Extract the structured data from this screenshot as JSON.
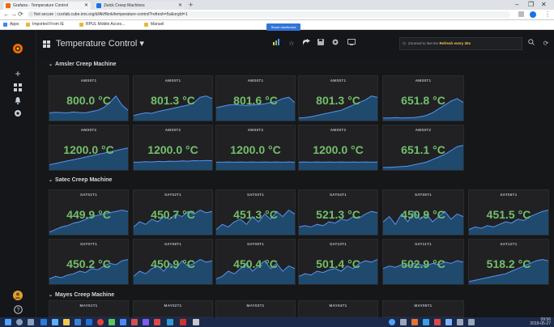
{
  "browser": {
    "tabs": [
      {
        "title": "Grafana - Temperature Control",
        "fav_color": "#f46800"
      },
      {
        "title": "Zwick Creep Machines",
        "fav_color": "#1a73e8"
      }
    ],
    "new_tab": "+",
    "window_controls": [
      "–",
      "❐",
      "✕"
    ],
    "nav": [
      "←",
      "→",
      "⟳",
      "⌂"
    ],
    "url_security": "Not secure",
    "url": "ccsrlab.cube.inrs.org/d/AkHbnk/temperature-control?refresh=5s&orgId=1",
    "bookmarks": [
      "Apps",
      "Imported From IE",
      "RPUL Mobile Acces...",
      "Manuel"
    ]
  },
  "sidebar": {
    "icons": [
      "grafana-logo-icon",
      "plus-icon",
      "dashboards-icon",
      "alert-bell-icon",
      "gear-icon",
      "user-avatar-icon",
      "help-icon"
    ]
  },
  "topnav": {
    "title": "Temperature Control ▾",
    "tooltip": "Share dashboard",
    "time_range": "Zoomed to last 5m",
    "refresh_label": "Refresh every 30s"
  },
  "colors": {
    "value": "#73bf69",
    "spark_fill": "#1f4a6e",
    "spark_line": "#5794f2",
    "panel_bg": "#212124"
  },
  "rows": [
    {
      "title": "Amsler Creep Machine",
      "panels": [
        {
          "title": "AMS0T1",
          "value": "800.0 °C",
          "spark": [
            0.3,
            0.32,
            0.31,
            0.3,
            0.33,
            0.31,
            0.3,
            0.35,
            0.4,
            0.5,
            0.7,
            0.95,
            0.6,
            0.4
          ]
        },
        {
          "title": "AMS0T1",
          "value": "801.3 °C",
          "spark": [
            0.2,
            0.25,
            0.3,
            0.28,
            0.35,
            0.4,
            0.45,
            0.5,
            0.55,
            0.6,
            0.7,
            0.9,
            0.95,
            0.85
          ]
        },
        {
          "title": "AMS0T1",
          "value": "801.6 °C",
          "spark": [
            0.5,
            0.55,
            0.6,
            0.62,
            0.6,
            0.58,
            0.6,
            0.62,
            0.65,
            0.7,
            0.75,
            0.85,
            0.9,
            0.7
          ]
        },
        {
          "title": "AMS0T1",
          "value": "801.3 °C",
          "spark": [
            0.1,
            0.12,
            0.15,
            0.2,
            0.25,
            0.3,
            0.35,
            0.4,
            0.5,
            0.6,
            0.7,
            0.8,
            0.95,
            0.9
          ]
        },
        {
          "title": "AMS0T1",
          "value": "651.8 °C",
          "spark": [
            0.1,
            0.1,
            0.12,
            0.1,
            0.11,
            0.12,
            0.15,
            0.2,
            0.3,
            0.45,
            0.6,
            0.75,
            0.85,
            0.7
          ]
        }
      ]
    },
    {
      "title": "",
      "panels": [
        {
          "title": "AMS0T2",
          "value": "1200.0 °C",
          "spark": [
            0.2,
            0.25,
            0.3,
            0.35,
            0.4,
            0.45,
            0.5,
            0.55,
            0.6,
            0.65,
            0.7,
            0.75,
            0.8,
            0.85
          ]
        },
        {
          "title": "AMS0T2",
          "value": "1200.0 °C",
          "spark": [
            0.3,
            0.3,
            0.32,
            0.31,
            0.33,
            0.32,
            0.34,
            0.33,
            0.35,
            0.34,
            0.36,
            0.35,
            0.37,
            0.36
          ]
        },
        {
          "title": "AMS0T2",
          "value": "1200.0 °C",
          "spark": [
            0.3,
            0.3,
            0.31,
            0.3,
            0.31,
            0.3,
            0.31,
            0.3,
            0.31,
            0.3,
            0.31,
            0.3,
            0.31,
            0.3
          ]
        },
        {
          "title": "AMS0T2",
          "value": "1200.0 °C",
          "spark": [
            0.3,
            0.31,
            0.3,
            0.31,
            0.3,
            0.31,
            0.3,
            0.31,
            0.3,
            0.31,
            0.3,
            0.31,
            0.3,
            0.31
          ]
        },
        {
          "title": "AMS0T2",
          "value": "651.1 °C",
          "spark": [
            0.1,
            0.1,
            0.12,
            0.13,
            0.15,
            0.2,
            0.25,
            0.3,
            0.4,
            0.5,
            0.6,
            0.75,
            0.9,
            0.95
          ]
        }
      ]
    },
    {
      "title": "Satec Creep Machine",
      "panels": [
        {
          "title": "SAT01T1",
          "value": "449.9 °C",
          "spark": [
            0.1,
            0.2,
            0.3,
            0.35,
            0.45,
            0.5,
            0.6,
            0.7,
            0.75,
            0.8,
            0.85,
            0.9,
            0.95,
            0.9
          ]
        },
        {
          "title": "SAT02T1",
          "value": "450.7 °C",
          "spark": [
            0.3,
            0.5,
            0.4,
            0.6,
            0.5,
            0.7,
            0.6,
            0.8,
            0.7,
            0.9,
            0.8,
            0.95,
            0.85,
            0.9
          ]
        },
        {
          "title": "SAT03T1",
          "value": "451.3 °C",
          "spark": [
            0.2,
            0.4,
            0.3,
            0.5,
            0.6,
            0.4,
            0.7,
            0.5,
            0.8,
            0.6,
            0.9,
            0.7,
            0.95,
            0.8
          ]
        },
        {
          "title": "SAT04T1",
          "value": "521.3 °C",
          "spark": [
            0.3,
            0.35,
            0.3,
            0.4,
            0.35,
            0.5,
            0.45,
            0.6,
            0.55,
            0.7,
            0.65,
            0.8,
            0.9,
            0.85
          ]
        },
        {
          "title": "SAT05T1",
          "value": "450.9 °C",
          "spark": [
            0.5,
            0.7,
            0.4,
            0.8,
            0.5,
            0.9,
            0.6,
            0.8,
            0.5,
            0.7,
            0.9,
            0.6,
            0.8,
            0.7
          ]
        },
        {
          "title": "SAT06T1",
          "value": "451.5 °C",
          "spark": [
            0.2,
            0.3,
            0.25,
            0.35,
            0.3,
            0.4,
            0.5,
            0.45,
            0.6,
            0.55,
            0.7,
            0.8,
            0.9,
            0.95
          ]
        }
      ]
    },
    {
      "title": "",
      "panels": [
        {
          "title": "SAT07T1",
          "value": "450.2 °C",
          "spark": [
            0.2,
            0.3,
            0.25,
            0.35,
            0.4,
            0.5,
            0.45,
            0.6,
            0.55,
            0.7,
            0.8,
            0.75,
            0.9,
            0.95
          ]
        },
        {
          "title": "SAT08T1",
          "value": "450.9 °C",
          "spark": [
            0.3,
            0.5,
            0.4,
            0.6,
            0.7,
            0.5,
            0.8,
            0.6,
            0.9,
            0.7,
            0.8,
            0.95,
            0.85,
            0.9
          ]
        },
        {
          "title": "SAT09T1",
          "value": "450.4 °C",
          "spark": [
            0.2,
            0.3,
            0.5,
            0.4,
            0.6,
            0.8,
            0.5,
            0.7,
            0.9,
            0.6,
            0.8,
            0.5,
            0.7,
            0.6
          ]
        },
        {
          "title": "SAT10T1",
          "value": "501.4 °C",
          "spark": [
            0.3,
            0.4,
            0.35,
            0.5,
            0.45,
            0.55,
            0.6,
            0.5,
            0.7,
            0.6,
            0.8,
            0.9,
            0.85,
            0.95
          ]
        },
        {
          "title": "SAT11T1",
          "value": "502.9 °C",
          "spark": [
            0.6,
            0.7,
            0.65,
            0.75,
            0.7,
            0.8,
            0.75,
            0.7,
            0.8,
            0.75,
            0.85,
            0.8,
            0.9,
            0.85
          ]
        },
        {
          "title": "SAT12T1",
          "value": "518.2 °C",
          "spark": [
            0.1,
            0.15,
            0.2,
            0.25,
            0.3,
            0.35,
            0.4,
            0.5,
            0.6,
            0.7,
            0.8,
            0.9,
            0.95,
            0.9
          ]
        }
      ]
    },
    {
      "title": "Mayes Creep Machine",
      "panels": [
        {
          "title": "MAY01T1",
          "value": "",
          "spark": []
        },
        {
          "title": "MAY02T1",
          "value": "",
          "spark": []
        },
        {
          "title": "MAY03T1",
          "value": "",
          "spark": []
        },
        {
          "title": "MAY04T1",
          "value": "",
          "spark": []
        },
        {
          "title": "MAY05T1",
          "value": "",
          "spark": []
        }
      ]
    }
  ],
  "taskbar": {
    "clock_time": "09:56",
    "clock_date": "2019-05-27"
  }
}
